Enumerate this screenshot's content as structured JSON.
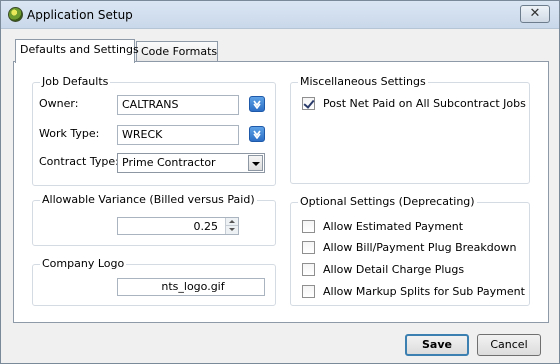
{
  "window": {
    "title": "Application Setup",
    "close_glyph": "✕"
  },
  "tabs": [
    {
      "label": "Defaults and Settings",
      "active": true
    },
    {
      "label": "Code Formats",
      "active": false
    }
  ],
  "job_defaults": {
    "legend": "Job Defaults",
    "owner_label": "Owner:",
    "owner_value": "CALTRANS",
    "work_type_label": "Work Type:",
    "work_type_value": "WRECK",
    "contract_type_label": "Contract Type:",
    "contract_type_value": "Prime Contractor"
  },
  "misc_settings": {
    "legend": "Miscellaneous Settings",
    "post_net_paid_label": "Post Net Paid on All Subcontract Jobs",
    "post_net_paid_checked": true
  },
  "allowable_variance": {
    "legend": "Allowable Variance (Billed versus Paid)",
    "value": "0.25"
  },
  "optional_settings": {
    "legend": "Optional Settings (Deprecating)",
    "items": [
      {
        "label": "Allow Estimated Payment",
        "checked": false
      },
      {
        "label": "Allow Bill/Payment Plug Breakdown",
        "checked": false
      },
      {
        "label": "Allow Detail Charge Plugs",
        "checked": false
      },
      {
        "label": "Allow Markup Splits for Sub Payment",
        "checked": false
      }
    ]
  },
  "company_logo": {
    "legend": "Company Logo",
    "value": "nts_logo.gif"
  },
  "buttons": {
    "save_label": "Save",
    "cancel_label": "Cancel"
  },
  "icons": {
    "app": "app-icon",
    "close": "close-icon",
    "download": "download-arrow-icon",
    "dropdown": "chevron-down-icon",
    "spin_up": "spin-up-icon",
    "spin_down": "spin-down-icon",
    "check": "checkmark-icon"
  },
  "colors": {
    "accent_blue": "#2c6fc6",
    "default_button_border": "#3c7fb1"
  }
}
